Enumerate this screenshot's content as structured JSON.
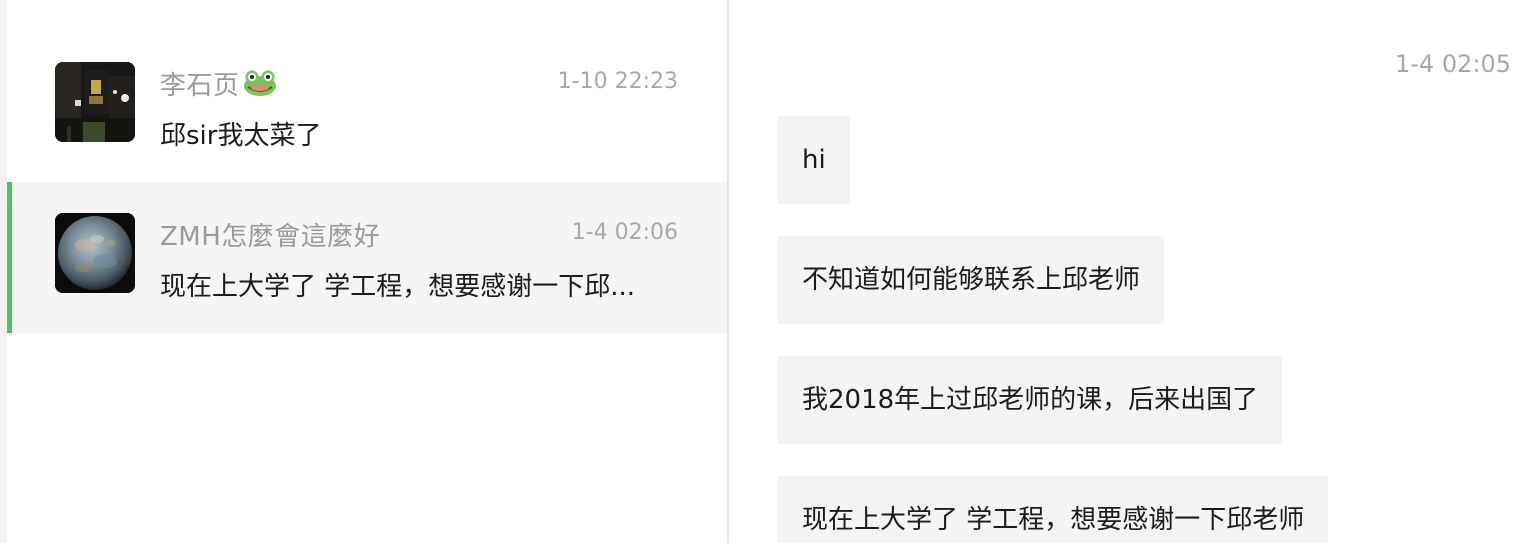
{
  "chat_list": [
    {
      "name": "李石页",
      "name_emoji": "frog-face-icon",
      "time": "1-10 22:23",
      "preview": "邱sir我太菜了",
      "avatar": "night-street-photo"
    },
    {
      "name": "ZMH怎麼會這麼好",
      "time": "1-4 02:06",
      "preview": "现在上大学了 学工程，想要感谢一下邱...",
      "avatar": "planet-photo",
      "selected": true
    }
  ],
  "conversation": {
    "timestamp": "1-4 02:05",
    "messages": [
      "hi",
      "不知道如何能够联系上邱老师",
      "我2018年上过邱老师的课，后来出国了",
      "现在上大学了 学工程，想要感谢一下邱老师"
    ]
  },
  "colors": {
    "selection_accent": "#4cc25b",
    "selected_row_bg": "#f5f5f5",
    "bubble_bg": "#f4f4f4",
    "muted_text": "#9a9a9a"
  }
}
